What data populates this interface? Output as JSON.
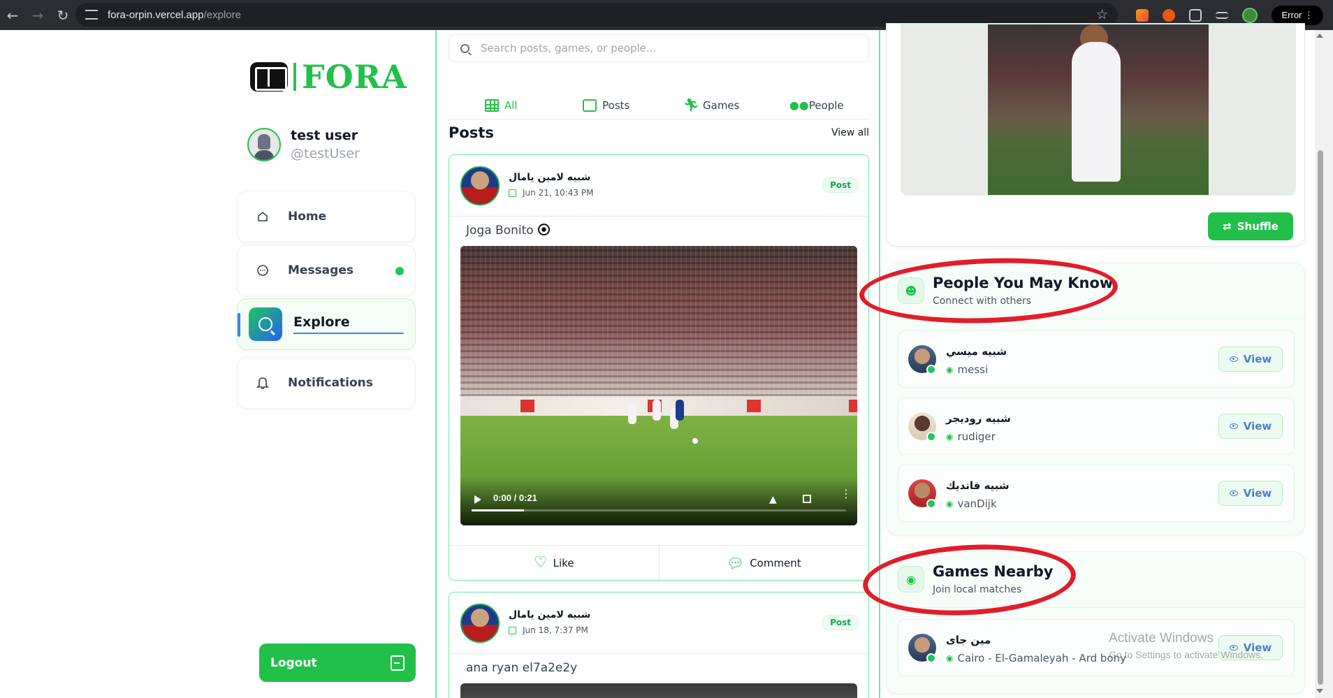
{
  "browser": {
    "url_host": "fora-orpin.vercel.app",
    "url_path": "/explore",
    "error_label": "Error",
    "back_icon": "back-arrow-icon",
    "forward_icon": "forward-arrow-icon",
    "reload_icon": "reload-icon"
  },
  "brand": {
    "name": "FORA",
    "accent": "#22c04a"
  },
  "user": {
    "name": "test user",
    "handle": "@testUser"
  },
  "nav": {
    "home": "Home",
    "messages": "Messages",
    "explore": "Explore",
    "notifications": "Notifications",
    "logout": "Logout"
  },
  "search": {
    "placeholder": "Search posts, games, or people..."
  },
  "tabs": {
    "all": "All",
    "posts": "Posts",
    "games": "Games",
    "people": "People"
  },
  "posts_section": {
    "title": "Posts",
    "view_all": "View all"
  },
  "posts": [
    {
      "author": "شبيه لامين يامال",
      "date": "Jun 21, 10:43 PM",
      "badge": "Post",
      "text": "Joga Bonito",
      "video": {
        "time": "0:00 / 0:21",
        "progress": 0.14
      },
      "like": "Like",
      "comment": "Comment"
    },
    {
      "author": "شبيه لامين يامال",
      "date": "Jun 18, 7:37 PM",
      "badge": "Post",
      "text": "ana ryan el7a2e2y"
    }
  ],
  "right": {
    "shuffle": "Shuffle",
    "people_panel": {
      "title": "People You May Know",
      "subtitle": "Connect with others",
      "people": [
        {
          "name": "شبيه ميسي",
          "handle": "messi",
          "view": "View"
        },
        {
          "name": "شبيه روديجر",
          "handle": "rudiger",
          "view": "View"
        },
        {
          "name": "شبيه فانديك",
          "handle": "vanDijk",
          "view": "View"
        }
      ]
    },
    "games_panel": {
      "title": "Games Nearby",
      "subtitle": "Join local matches",
      "games": [
        {
          "name": "مين جاى",
          "location": "Cairo - El-Gamaleyah - Ard bony",
          "view": "View"
        }
      ]
    }
  },
  "watermark": {
    "line1": "Activate Windows",
    "line2": "Go to Settings to activate Windows."
  }
}
